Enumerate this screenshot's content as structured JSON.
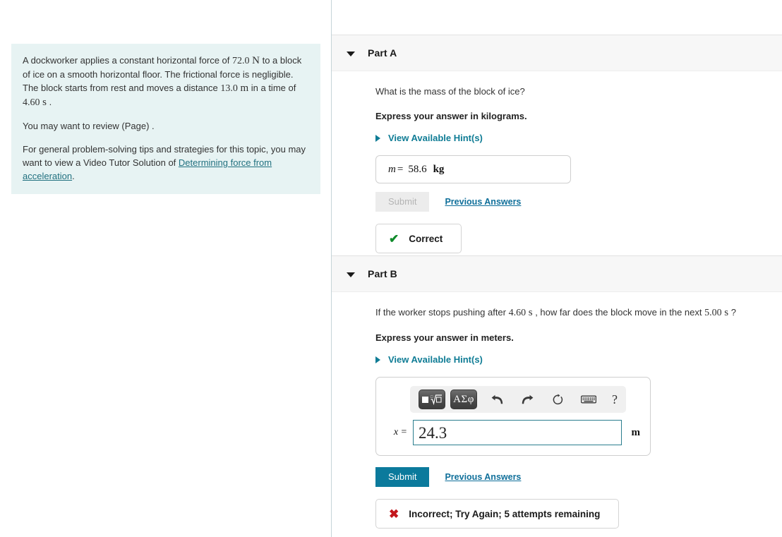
{
  "problem": {
    "paragraph1_a": "A dockworker applies a constant horizontal force of ",
    "paragraph1_force": "72.0",
    "paragraph1_force_unit": "N",
    "paragraph1_b": " to a block of ice on a smooth horizontal floor. The frictional force is negligible. The block starts from rest and moves a distance ",
    "paragraph1_distance": "13.0",
    "paragraph1_distance_unit": "m",
    "paragraph1_c": " in a time of ",
    "paragraph1_time": "4.60",
    "paragraph1_time_unit": "s",
    "paragraph1_d": " .",
    "paragraph2": "You may want to review (Page) .",
    "paragraph3_a": "For general problem-solving tips and strategies for this topic, you may want to view a Video Tutor Solution of ",
    "paragraph3_link": "Determining force from acceleration",
    "paragraph3_b": "."
  },
  "part_a": {
    "title": "Part A",
    "question": "What is the mass of the block of ice?",
    "express": "Express your answer in kilograms.",
    "hint_link": "View Available Hint(s)",
    "answer_variable": "m",
    "answer_equals": "=",
    "answer_value": "58.6",
    "answer_unit": "kg",
    "submit_label": "Submit",
    "previous_answers_label": "Previous Answers",
    "feedback_icon": "check-mark",
    "feedback_text": "Correct",
    "feedback_color": "#0f8a2a"
  },
  "part_b": {
    "title": "Part B",
    "question_a": "If the worker stops pushing after ",
    "question_time1": "4.60",
    "question_time1_unit": "s",
    "question_b": " , how far does the block move in the next ",
    "question_time2": "5.00",
    "question_time2_unit": "s",
    "question_c": " ?",
    "express": "Express your answer in meters.",
    "hint_link": "View Available Hint(s)",
    "toolbar": {
      "template_button": "square-root-template-icon",
      "greek_button_label": "ΑΣφ",
      "undo_icon": "undo-arrow-icon",
      "redo_icon": "redo-arrow-icon",
      "reset_icon": "reset-circular-arrow-icon",
      "keyboard_icon": "keyboard-icon",
      "help_label": "?"
    },
    "answer_variable": "x",
    "answer_equals": "=",
    "answer_value": "24.3",
    "answer_unit": "m",
    "submit_label": "Submit",
    "previous_answers_label": "Previous Answers",
    "feedback_icon": "cross-mark",
    "feedback_text": "Incorrect; Try Again; 5 attempts remaining",
    "feedback_color": "#c3161c"
  },
  "colors": {
    "accent_teal": "#0b7a9c",
    "link_blue": "#0f6f9a",
    "problem_bg": "#e7f3f3",
    "header_bg": "#f7f7f7",
    "correct_green": "#0f8a2a",
    "incorrect_red": "#c3161c"
  }
}
